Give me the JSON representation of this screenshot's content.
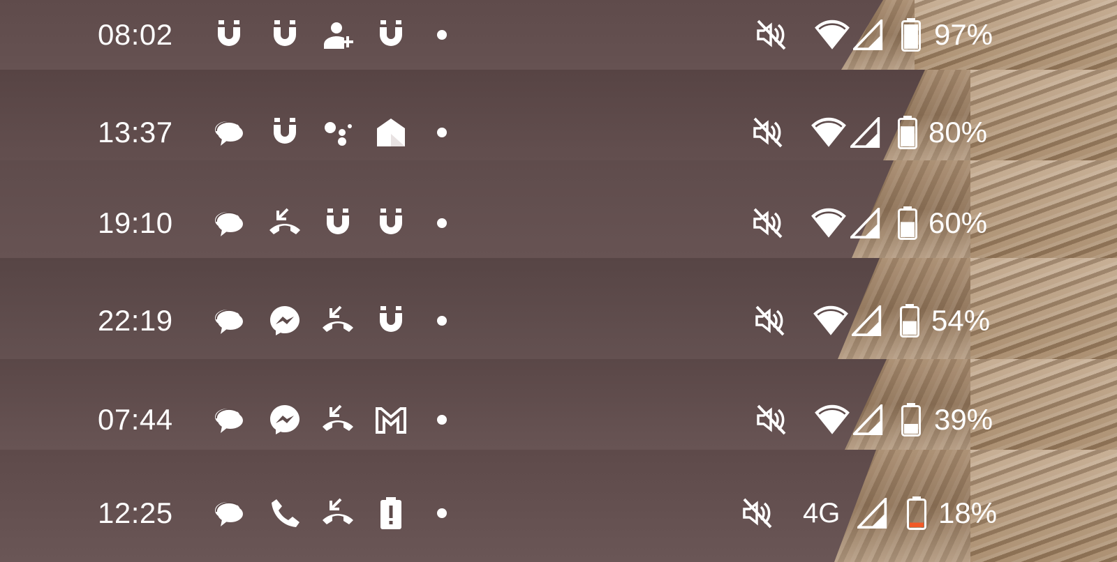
{
  "colors": {
    "bar_background": "#5d4a4a",
    "foreground": "#ffffff",
    "battery_low": "#f25a28"
  },
  "status_bars": [
    {
      "time": "08:02",
      "notification_icons": [
        "magnet-icon",
        "magnet-icon",
        "add-contact-icon",
        "magnet-icon"
      ],
      "overflow": "more-notifications-dot",
      "sound": "ringer-muted-icon",
      "network": "wifi",
      "network_label": "",
      "signal": "cell-signal-icon",
      "battery_level": 0.97,
      "battery_percent": "97%"
    },
    {
      "time": "13:37",
      "notification_icons": [
        "chat-bubbles-icon",
        "magnet-icon",
        "assistant-dots-icon",
        "inbox-envelope-icon"
      ],
      "overflow": "more-notifications-dot",
      "sound": "ringer-muted-icon",
      "network": "wifi",
      "network_label": "",
      "signal": "cell-signal-icon",
      "battery_level": 0.8,
      "battery_percent": "80%"
    },
    {
      "time": "19:10",
      "notification_icons": [
        "chat-bubbles-icon",
        "missed-call-icon",
        "magnet-icon",
        "magnet-icon"
      ],
      "overflow": "more-notifications-dot",
      "sound": "ringer-muted-icon",
      "network": "wifi",
      "network_label": "",
      "signal": "cell-signal-icon",
      "battery_level": 0.6,
      "battery_percent": "60%"
    },
    {
      "time": "22:19",
      "notification_icons": [
        "chat-bubbles-icon",
        "messenger-icon",
        "missed-call-icon",
        "magnet-icon"
      ],
      "overflow": "more-notifications-dot",
      "sound": "ringer-muted-icon",
      "network": "wifi",
      "network_label": "",
      "signal": "cell-signal-icon",
      "battery_level": 0.54,
      "battery_percent": "54%"
    },
    {
      "time": "07:44",
      "notification_icons": [
        "chat-bubbles-icon",
        "messenger-icon",
        "missed-call-icon",
        "gmail-icon"
      ],
      "overflow": "more-notifications-dot",
      "sound": "ringer-muted-icon",
      "network": "wifi",
      "network_label": "",
      "signal": "cell-signal-icon",
      "battery_level": 0.39,
      "battery_percent": "39%"
    },
    {
      "time": "12:25",
      "notification_icons": [
        "chat-bubbles-icon",
        "phone-call-icon",
        "missed-call-icon",
        "battery-alert-icon"
      ],
      "overflow": "more-notifications-dot",
      "sound": "ringer-muted-icon",
      "network": "4g",
      "network_label": "4G",
      "signal": "cell-signal-icon",
      "battery_level": 0.18,
      "battery_percent": "18%"
    }
  ]
}
